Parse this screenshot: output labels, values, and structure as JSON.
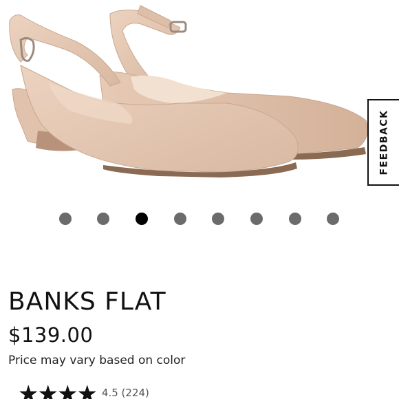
{
  "product": {
    "title": "BANKS FLAT",
    "price": "$139.00",
    "price_note": "Price may vary based on color",
    "rating_stars": "★★★★",
    "rating_text": "4.5  (224)"
  },
  "feedback": {
    "label": "FEEDBACK"
  },
  "carousel": {
    "total": 8,
    "active_index": 2
  },
  "colors": {
    "shoe_main": "#e2c4ae",
    "shoe_shadow": "#c9a78f",
    "shoe_lining": "#f0dcc9",
    "sole": "#8a6a52",
    "dot_inactive": "#6b6b6b",
    "dot_active": "#000000"
  }
}
